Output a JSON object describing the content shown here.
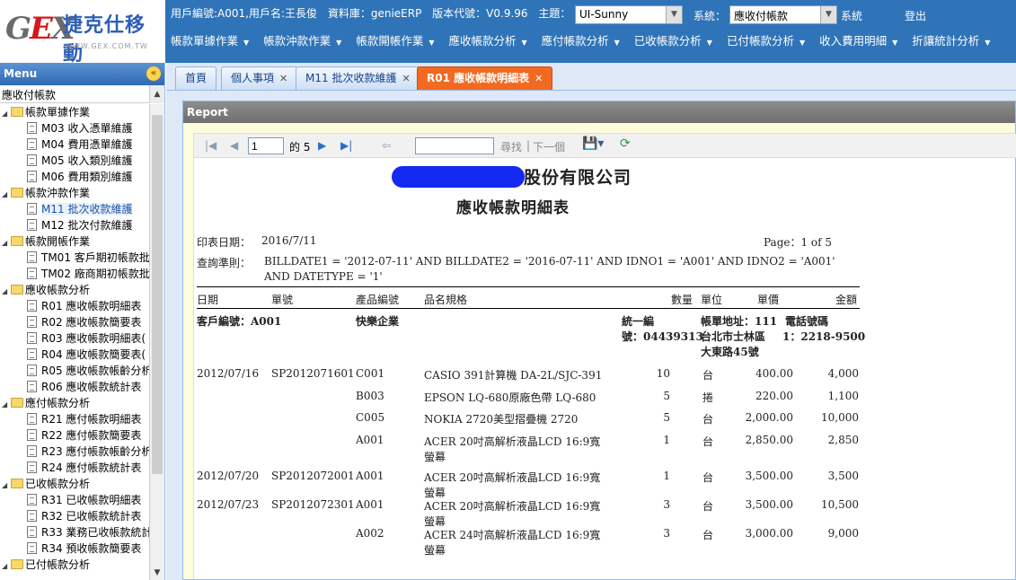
{
  "header": {
    "logo_text": "捷克仕移動",
    "logo_url": "WWW.GEX.COM.TW",
    "logo_mark": "GEX",
    "user_info": "用戶編號:A001,用戶名:王長俊",
    "db_label": "資料庫：genieERP",
    "version_label": "版本代號：V0.9.96",
    "theme_label": "主題：",
    "theme_value": "UI-Sunny",
    "system_label": "系統：",
    "system_value": "應收付帳款",
    "system_suffix": "系統",
    "logout_label": "登出"
  },
  "menubar": [
    "帳款單據作業",
    "帳款沖款作業",
    "帳款開帳作業",
    "應收帳款分析",
    "應付帳款分析",
    "已收帳款分析",
    "已付帳款分析",
    "收入費用明細",
    "折讓統計分析"
  ],
  "sidebar": {
    "title": "Menu",
    "filter_value": "應收付帳款",
    "tree": [
      {
        "type": "folder",
        "label": "帳款單據作業"
      },
      {
        "type": "leaf",
        "label": "M03 收入憑單維護"
      },
      {
        "type": "leaf",
        "label": "M04 費用憑單維護"
      },
      {
        "type": "leaf",
        "label": "M05 收入類別維護"
      },
      {
        "type": "leaf",
        "label": "M06 費用類別維護"
      },
      {
        "type": "folder",
        "label": "帳款沖款作業"
      },
      {
        "type": "leaf",
        "label": "M11 批次收款維護",
        "active": true
      },
      {
        "type": "leaf",
        "label": "M12 批次付款維護"
      },
      {
        "type": "folder",
        "label": "帳款開帳作業"
      },
      {
        "type": "leaf",
        "label": "TM01 客戶期初帳款批"
      },
      {
        "type": "leaf",
        "label": "TM02 廠商期初帳款批"
      },
      {
        "type": "folder",
        "label": "應收帳款分析"
      },
      {
        "type": "leaf",
        "label": "R01 應收帳款明細表"
      },
      {
        "type": "leaf",
        "label": "R02 應收帳款簡要表"
      },
      {
        "type": "leaf",
        "label": "R03 應收帳款明細表("
      },
      {
        "type": "leaf",
        "label": "R04 應收帳款簡要表("
      },
      {
        "type": "leaf",
        "label": "R05 應收帳款帳齡分析"
      },
      {
        "type": "leaf",
        "label": "R06 應收帳款統計表"
      },
      {
        "type": "folder",
        "label": "應付帳款分析"
      },
      {
        "type": "leaf",
        "label": "R21 應付帳款明細表"
      },
      {
        "type": "leaf",
        "label": "R22 應付帳款簡要表"
      },
      {
        "type": "leaf",
        "label": "R23 應付帳款帳齡分析"
      },
      {
        "type": "leaf",
        "label": "R24 應付帳款統計表"
      },
      {
        "type": "folder",
        "label": "已收帳款分析"
      },
      {
        "type": "leaf",
        "label": "R31 已收帳款明細表"
      },
      {
        "type": "leaf",
        "label": "R32 已收帳款統計表"
      },
      {
        "type": "leaf",
        "label": "R33 業務已收帳款統計"
      },
      {
        "type": "leaf",
        "label": "R34 預收帳款簡要表"
      },
      {
        "type": "folder",
        "label": "已付帳款分析"
      }
    ]
  },
  "tabs": [
    {
      "label": "首頁",
      "closable": false
    },
    {
      "label": "個人事項",
      "closable": true
    },
    {
      "label": "M11 批次收款維護",
      "closable": true
    },
    {
      "label": "R01 應收帳款明細表",
      "closable": true,
      "active": true
    }
  ],
  "report_panel": {
    "title": "Report",
    "toolbar": {
      "page_value": "1",
      "of_label": "的 5",
      "find_label": "尋找",
      "next_label": "下一個"
    }
  },
  "report": {
    "company_suffix": "股份有限公司",
    "title": "應收帳款明細表",
    "print_date_label": "印表日期：",
    "print_date": "2016/7/11",
    "page_label": "Page：1 of 5",
    "criteria_label": "查詢準則：",
    "criteria_line1": "BILLDATE1 = '2012-07-11' AND BILLDATE2 = '2016-07-11' AND IDNO1 = 'A001' AND IDNO2 = 'A001'",
    "criteria_line2": "AND DATETYPE = '1'",
    "columns": {
      "date": "日期",
      "doc_no": "單號",
      "product_code": "產品編號",
      "product_name": "品名規格",
      "qty": "數量",
      "unit": "單位",
      "price": "單價",
      "amount": "金額"
    },
    "customer": {
      "code_label": "客戶編號：A001",
      "name": "快樂企業",
      "tax_label": "統一編",
      "tax_value": "號：04439313",
      "addr_label": "帳單地址：111",
      "addr_line2": "台北市士林區",
      "addr_line3": "大東路45號",
      "phone_label": "電話號碼",
      "phone_value": "1：2218-9500"
    },
    "rows": [
      {
        "date": "2012/07/16",
        "doc": "SP2012071601",
        "code": "C001",
        "name1": "CASIO  391計算機  DA-2L/SJC-391",
        "name2": "",
        "qty": "10",
        "unit": "台",
        "price": "400.00",
        "amount": "4,000"
      },
      {
        "date": "",
        "doc": "",
        "code": "B003",
        "name1": "EPSON LQ-680原廠色帶   LQ-680",
        "name2": "",
        "qty": "5",
        "unit": "捲",
        "price": "220.00",
        "amount": "1,100"
      },
      {
        "date": "",
        "doc": "",
        "code": "C005",
        "name1": "NOKIA 2720美型摺疊機   2720",
        "name2": "",
        "qty": "5",
        "unit": "台",
        "price": "2,000.00",
        "amount": "10,000"
      },
      {
        "date": "",
        "doc": "",
        "code": "A001",
        "name1": "ACER 20吋高解析液晶LCD   16:9寬",
        "name2": "螢幕",
        "qty": "1",
        "unit": "台",
        "price": "2,850.00",
        "amount": "2,850"
      },
      {
        "date": "2012/07/20",
        "doc": "SP2012072001",
        "code": "A001",
        "name1": "ACER 20吋高解析液晶LCD   16:9寬",
        "name2": "螢幕",
        "qty": "1",
        "unit": "台",
        "price": "3,500.00",
        "amount": "3,500"
      },
      {
        "date": "2012/07/23",
        "doc": "SP2012072301",
        "code": "A001",
        "name1": "ACER 20吋高解析液晶LCD   16:9寬",
        "name2": "螢幕",
        "qty": "3",
        "unit": "台",
        "price": "3,500.00",
        "amount": "10,500"
      },
      {
        "date": "",
        "doc": "",
        "code": "A002",
        "name1": "ACER 24吋高解析液晶LCD   16:9寬",
        "name2": "螢幕",
        "qty": "3",
        "unit": "台",
        "price": "3,000.00",
        "amount": "9,000"
      }
    ]
  }
}
